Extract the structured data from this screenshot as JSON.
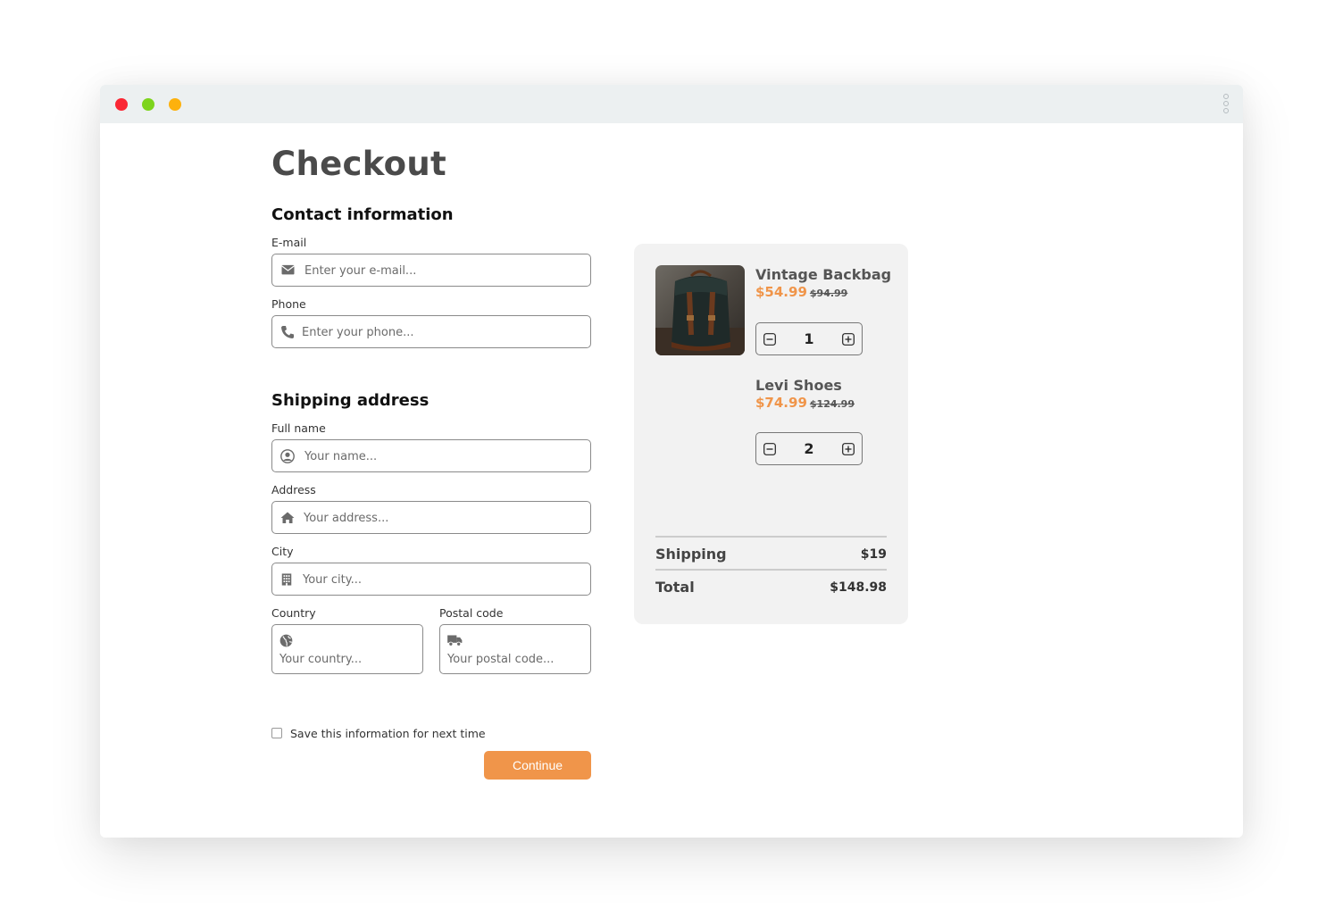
{
  "page": {
    "title": "Checkout"
  },
  "contact": {
    "title": "Contact information",
    "email": {
      "label": "E-mail",
      "placeholder": "Enter your e-mail...",
      "icon": "envelope-icon"
    },
    "phone": {
      "label": "Phone",
      "placeholder": "Enter your phone...",
      "icon": "phone-icon"
    }
  },
  "shipping": {
    "title": "Shipping address",
    "fullname": {
      "label": "Full name",
      "placeholder": "Your name...",
      "icon": "user-icon"
    },
    "address": {
      "label": "Address",
      "placeholder": "Your address...",
      "icon": "home-icon"
    },
    "city": {
      "label": "City",
      "placeholder": "Your city...",
      "icon": "building-icon"
    },
    "country": {
      "label": "Country",
      "placeholder": "Your country...",
      "icon": "globe-icon"
    },
    "postal": {
      "label": "Postal code",
      "placeholder": "Your postal code...",
      "icon": "truck-icon"
    }
  },
  "save_info": {
    "label": "Save this information for next time",
    "checked": false
  },
  "continue_label": "Continue",
  "cart": {
    "items": [
      {
        "name": "Vintage Backbag",
        "price": "$54.99",
        "old_price": "$94.99",
        "qty": "1"
      },
      {
        "name": "Levi Shoes",
        "price": "$74.99",
        "old_price": "$124.99",
        "qty": "2"
      }
    ],
    "shipping_label": "Shipping",
    "shipping_value": "$19",
    "total_label": "Total",
    "total_value": "$148.98"
  },
  "colors": {
    "accent": "#f0954a",
    "titlebar": "#ecf0f1",
    "cart_bg": "#f2f2f2"
  }
}
